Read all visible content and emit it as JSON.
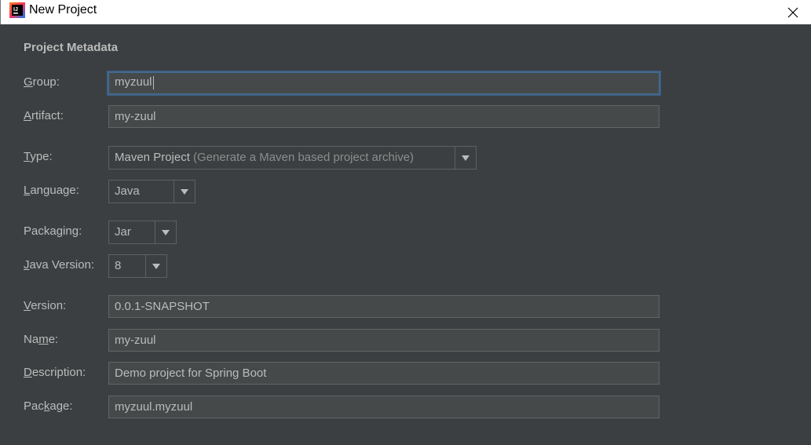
{
  "window": {
    "title": "New Project"
  },
  "section": {
    "title": "Project Metadata"
  },
  "labels": {
    "group_u": "G",
    "group_rest": "roup:",
    "artifact_u": "A",
    "artifact_rest": "rtifact:",
    "type_u": "T",
    "type_rest": "ype:",
    "language_u": "L",
    "language_rest": "anguage:",
    "packaging_pre": "Packa",
    "packaging_u": "g",
    "packaging_rest": "ing:",
    "javaversion_u": "J",
    "javaversion_rest": "ava Version:",
    "version_u": "V",
    "version_rest": "ersion:",
    "name_pre": "Na",
    "name_u": "m",
    "name_rest": "e:",
    "description_u": "D",
    "description_rest": "escription:",
    "package_pre": "Pac",
    "package_u": "k",
    "package_rest": "age:"
  },
  "fields": {
    "group": "myzuul",
    "artifact": "my-zuul",
    "version": "0.0.1-SNAPSHOT",
    "name": "my-zuul",
    "description": "Demo project for Spring Boot",
    "package": "myzuul.myzuul"
  },
  "selects": {
    "type": {
      "value": "Maven Project",
      "hint": "(Generate a Maven based project archive)"
    },
    "language": {
      "value": "Java"
    },
    "packaging": {
      "value": "Jar"
    },
    "java_version": {
      "value": "8"
    }
  },
  "icons": {
    "app": "intellij-idea-icon",
    "close": "close-icon",
    "dropdown": "chevron-down-icon"
  }
}
